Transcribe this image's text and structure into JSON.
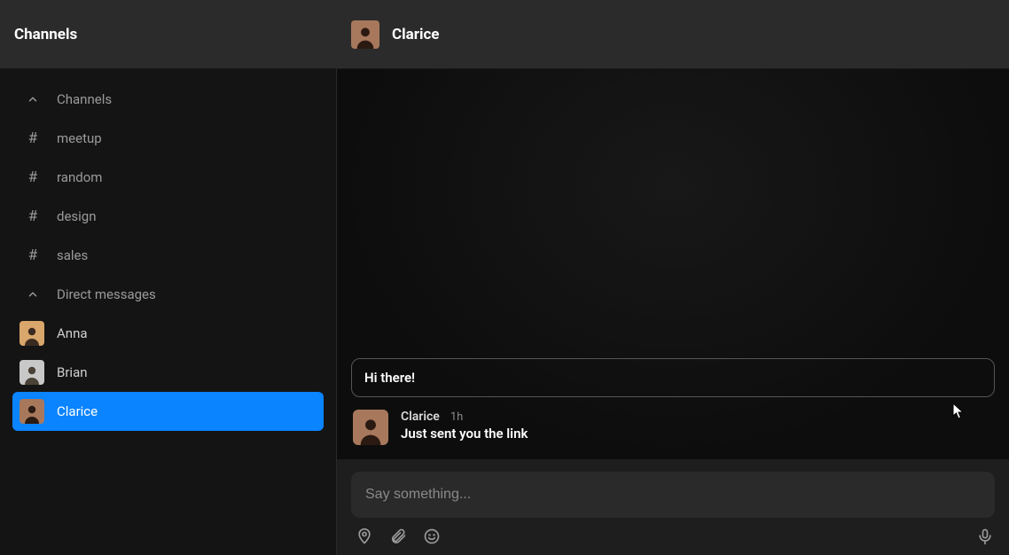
{
  "sidebar": {
    "title": "Channels",
    "sections": {
      "channels": {
        "label": "Channels",
        "items": [
          {
            "name": "meetup"
          },
          {
            "name": "random"
          },
          {
            "name": "design"
          },
          {
            "name": "sales"
          }
        ]
      },
      "dms": {
        "label": "Direct messages",
        "items": [
          {
            "name": "Anna",
            "avatar_bg": "#d9a66b",
            "selected": false
          },
          {
            "name": "Brian",
            "avatar_bg": "#c8c8c8",
            "selected": false
          },
          {
            "name": "Clarice",
            "avatar_bg": "#a8785c",
            "selected": true
          }
        ]
      }
    }
  },
  "header": {
    "title": "Clarice",
    "avatar_bg": "#a8785c"
  },
  "conversation": {
    "bubble_text": "Hi there!",
    "message": {
      "author": "Clarice",
      "time": "1h",
      "text": "Just sent you the link",
      "avatar_bg": "#a8785c"
    }
  },
  "composer": {
    "placeholder": "Say something..."
  }
}
